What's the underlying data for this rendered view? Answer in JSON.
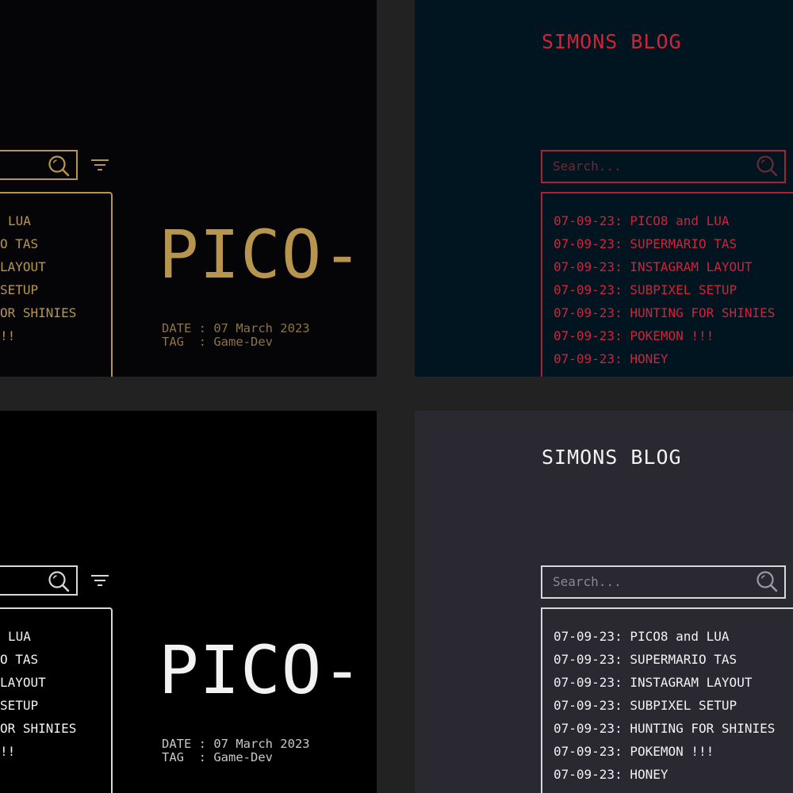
{
  "blog_title": "SIMONS BLOG",
  "search_placeholder": "Search...",
  "posts": [
    "07-09-23: PICO8 and LUA",
    "07-09-23: SUPERMARIO TAS",
    "07-09-23: INSTAGRAM LAYOUT",
    "07-09-23: SUBPIXEL SETUP",
    "07-09-23: HUNTING FOR SHINIES",
    "07-09-23: POKEMON !!!",
    "07-09-23: HONEY"
  ],
  "left_posts_cropped": [
    "LUA",
    "O TAS",
    " LAYOUT",
    "SETUP",
    "OR SHINIES",
    "!!"
  ],
  "article": {
    "title": "PICO-",
    "date_line": "DATE : 07 March 2023",
    "tag_line": "TAG  : Game-Dev"
  },
  "themes": {
    "gold": {
      "accent": "#b8954f",
      "meta": "#8c7444",
      "background": "#050507"
    },
    "crimson": {
      "accent": "#d0233a",
      "placeholder": "#6b2a35",
      "background": "#011520"
    },
    "mono_dark": {
      "accent": "#f2f2f2",
      "meta": "#c8c8c8",
      "background": "#000000"
    },
    "mono_gray": {
      "accent": "#f2f2f2",
      "placeholder": "#8a8a92",
      "background": "#2a2830"
    }
  },
  "icons": [
    "search-icon",
    "filter-icon"
  ]
}
